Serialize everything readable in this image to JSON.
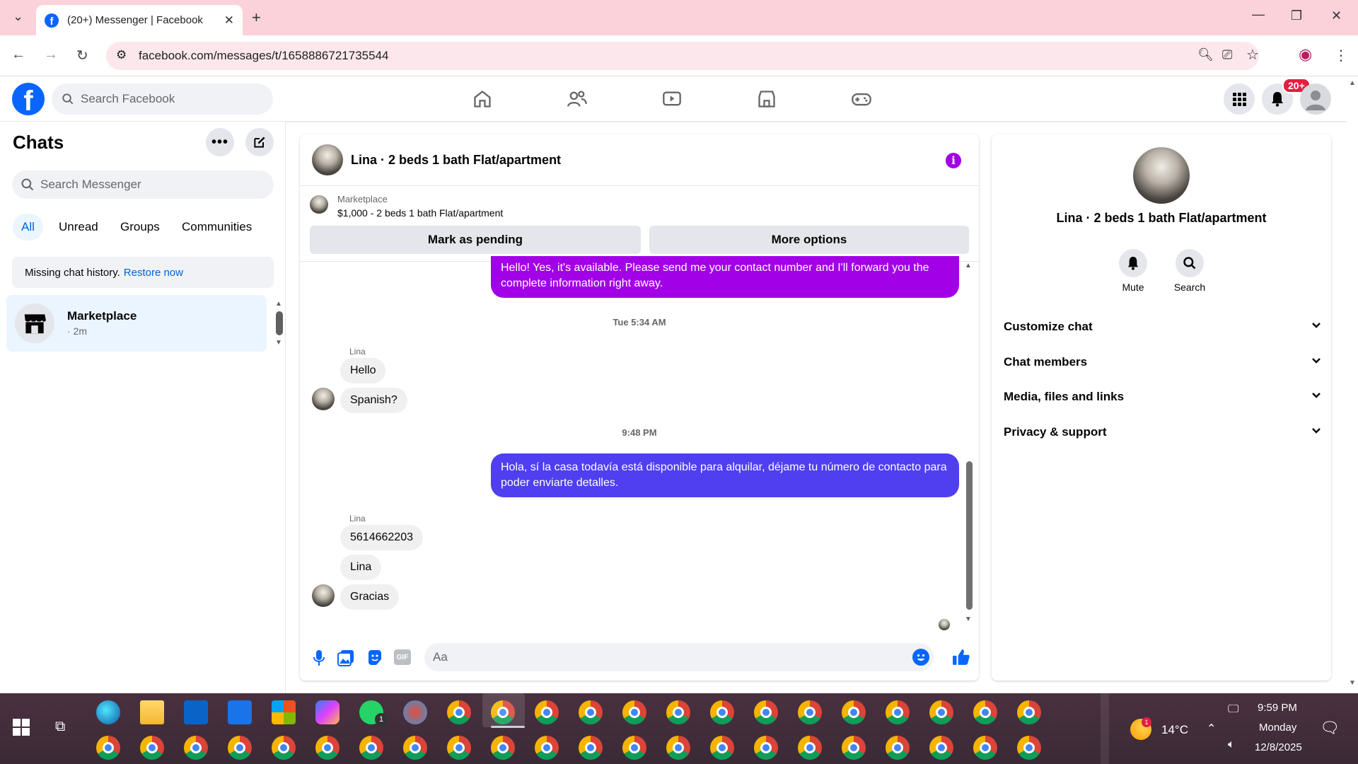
{
  "browser": {
    "tab_title": "(20+) Messenger | Facebook",
    "url": "facebook.com/messages/t/1658886721735544"
  },
  "facebook": {
    "search_placeholder": "Search Facebook",
    "notification_badge": "20+"
  },
  "chats": {
    "title": "Chats",
    "search_placeholder": "Search Messenger",
    "filters": [
      "All",
      "Unread",
      "Groups",
      "Communities"
    ],
    "missing_history": "Missing chat history.",
    "restore_link": "Restore now",
    "items": [
      {
        "name": "Marketplace",
        "time": "· 2m"
      }
    ]
  },
  "conversation": {
    "title": "Lina · 2 beds 1 bath Flat/apartment",
    "marketplace_label": "Marketplace",
    "listing": "$1,000 - 2 beds 1 bath Flat/apartment",
    "mark_pending": "Mark as pending",
    "more_options": "More options",
    "messages": [
      {
        "type": "out",
        "text": "Hello! Yes, it's available. Please send me your contact number and I'll forward you the complete information right away."
      },
      {
        "type": "timestamp",
        "text": "Tue 5:34 AM"
      },
      {
        "type": "sender",
        "text": "Lina"
      },
      {
        "type": "in",
        "text": "Hello"
      },
      {
        "type": "in",
        "text": "Spanish?"
      },
      {
        "type": "timestamp",
        "text": "9:48 PM"
      },
      {
        "type": "out",
        "text": "Hola, sí la casa todavía está disponible para alquilar, déjame tu número de contacto para poder enviarte detalles."
      },
      {
        "type": "sender",
        "text": "Lina"
      },
      {
        "type": "in",
        "text": "5614662203"
      },
      {
        "type": "in",
        "text": "Lina"
      },
      {
        "type": "in",
        "text": "Gracias"
      }
    ],
    "input_placeholder": "Aa"
  },
  "details": {
    "name": "Lina · 2 beds 1 bath Flat/apartment",
    "actions": [
      "Mute",
      "Search"
    ],
    "sections": [
      "Customize chat",
      "Chat members",
      "Media, files and links",
      "Privacy & support"
    ]
  },
  "taskbar": {
    "weather_temp": "14°C",
    "weather_badge": "1",
    "whatsapp_badge": "1",
    "time": "9:59 PM",
    "day": "Monday",
    "date": "12/8/2025"
  },
  "colors": {
    "fb_blue": "#0866ff",
    "bubble_purple": "#a200e6",
    "bubble_indigo": "#4f3ff0",
    "active_filter_bg": "#ebf5ff"
  }
}
